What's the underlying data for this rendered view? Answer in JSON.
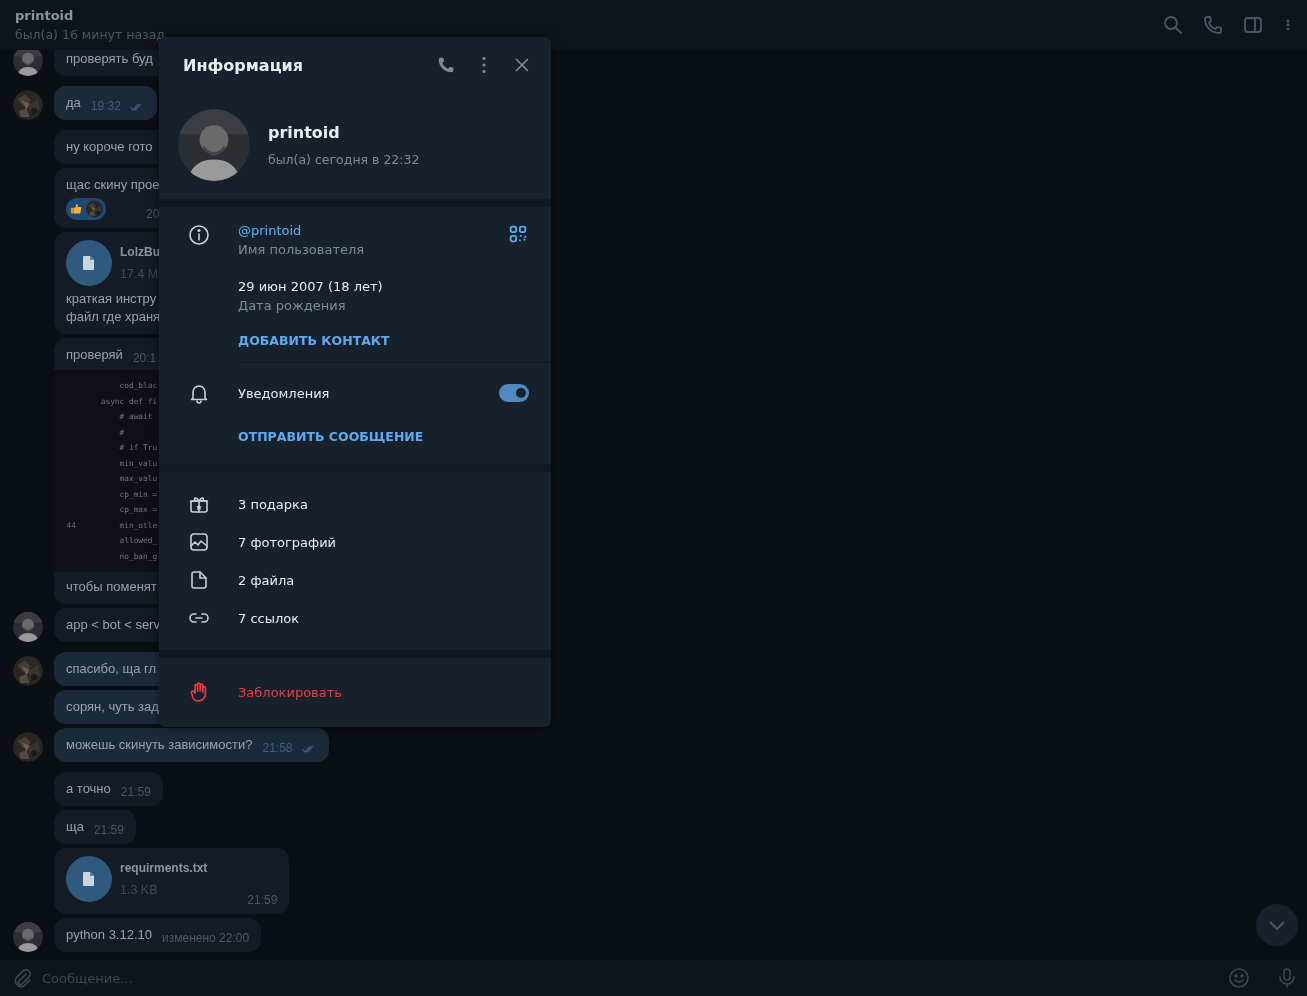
{
  "header": {
    "title": "printoid",
    "status": "был(а) 16 минут назад"
  },
  "messages": [
    {
      "kind": "text",
      "outgoing": false,
      "text": "проверять буд",
      "clipped": true,
      "sender_avatar": true
    },
    {
      "kind": "text",
      "outgoing": true,
      "text": "да",
      "time": "19:32",
      "read": true,
      "sender_avatar": true
    },
    {
      "kind": "text",
      "outgoing": false,
      "text": "ну короче гото",
      "clipped": true
    },
    {
      "kind": "text",
      "outgoing": false,
      "text": "щас скину прое",
      "time": "20",
      "clipped": true,
      "reaction": true
    },
    {
      "kind": "file",
      "outgoing": false,
      "file_name": "LolzBu",
      "file_size": "17.4 M",
      "text": "краткая инстру\nфайл где храня",
      "clipped": true
    },
    {
      "kind": "code",
      "outgoing": false,
      "text": "проверяй",
      "time": "20:1",
      "clipped": true,
      "code": [
        {
          "text": "        cod_blac"
        },
        {
          "text": "    async def fi"
        },
        {
          "text": "        # await"
        },
        {
          "text": "        #"
        },
        {
          "text": "        # if Tru"
        },
        {
          "text": "        min_valu"
        },
        {
          "text": "        max_valu"
        },
        {
          "text": "        cp_min ="
        },
        {
          "text": "        cp_max ="
        },
        {
          "text": "        min_otle",
          "number": "44"
        },
        {
          "text": "        allowed_"
        },
        {
          "text": "        no_ban_g"
        }
      ],
      "caption": "чтобы поменят"
    },
    {
      "kind": "text",
      "outgoing": false,
      "text": "app < bot < serv",
      "clipped": true,
      "sender_avatar": true
    },
    {
      "kind": "text",
      "outgoing": true,
      "text": "спасибо, ща гл",
      "clipped": true,
      "sender_avatar": true
    },
    {
      "kind": "text",
      "outgoing": true,
      "text": "сорян, чуть зад",
      "clipped": true
    },
    {
      "kind": "text",
      "outgoing": true,
      "text": "можешь скинуть зависимости?",
      "time": "21:58",
      "read": true,
      "sender_avatar": true
    },
    {
      "kind": "text",
      "outgoing": false,
      "text": "а точно",
      "time": "21:59"
    },
    {
      "kind": "text",
      "outgoing": false,
      "text": "ща",
      "time": "21:59"
    },
    {
      "kind": "file",
      "outgoing": false,
      "file_name": "requirments.txt",
      "file_size": "1.3 KB",
      "time": "21:59"
    },
    {
      "kind": "text",
      "outgoing": false,
      "text": "python 3.12.10",
      "time": "изменено 22:00",
      "sender_avatar": true
    }
  ],
  "composer": {
    "placeholder": "Сообщение..."
  },
  "info_panel": {
    "title": "Информация",
    "name": "printoid",
    "status": "был(а) сегодня в 22:32",
    "username": "@printoid",
    "username_label": "Имя пользователя",
    "birthday": "29 июн 2007 (18 лет)",
    "birthday_label": "Дата рождения",
    "add_contact": "ДОБАВИТЬ КОНТАКТ",
    "notifications": {
      "label": "Уведомления",
      "on": true
    },
    "send_message": "ОТПРАВИТЬ СООБЩЕНИЕ",
    "media": [
      {
        "kind": "gifts",
        "label": "3 подарка"
      },
      {
        "kind": "photos",
        "label": "7 фотографий"
      },
      {
        "kind": "files",
        "label": "2 файла"
      },
      {
        "kind": "links",
        "label": "7 ссылок"
      }
    ],
    "block": "Заблокировать"
  }
}
